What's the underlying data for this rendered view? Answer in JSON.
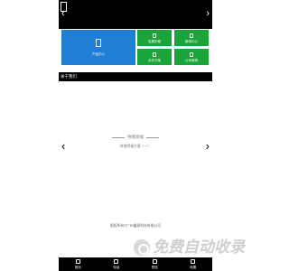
{
  "header": {
    "menu_icon": "menu-icon",
    "nav_left": "‹",
    "nav_right": "›"
  },
  "tiles": {
    "main": {
      "label": "产品中心",
      "color": "#1e7fd4"
    },
    "items": [
      {
        "label": "发展历程",
        "color": "#1aa43a"
      },
      {
        "label": "新闻中心",
        "color": "#1aa43a"
      },
      {
        "label": "合作方案",
        "color": "#1aa43a"
      },
      {
        "label": "公司新闻",
        "color": "#1aa43a"
      }
    ]
  },
  "about": {
    "label": "关于我们"
  },
  "carousel": {
    "prev": "‹",
    "next": "›",
    "placeholder_title": "待增资福",
    "placeholder_sub": "待增资福方案（一）"
  },
  "footer": {
    "copyright": "版权所有©广州鑫源科技有限公司"
  },
  "bottom_nav": [
    {
      "label": "首页",
      "icon": "home-icon"
    },
    {
      "label": "电话",
      "icon": "phone-icon"
    },
    {
      "label": "短信",
      "icon": "message-icon"
    },
    {
      "label": "地图",
      "icon": "map-icon"
    }
  ],
  "watermark": {
    "text": "免费自动收录"
  }
}
